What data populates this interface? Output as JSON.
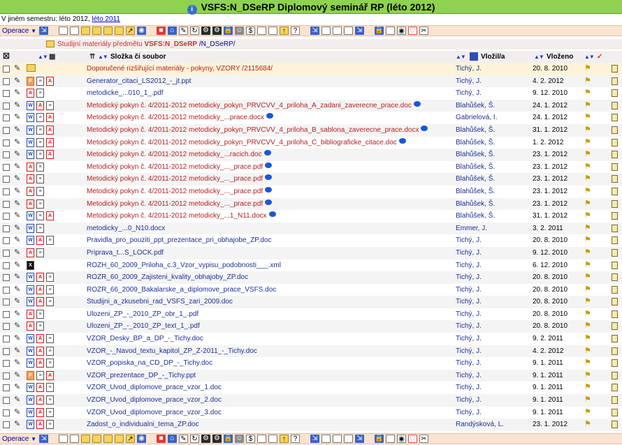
{
  "title": "VSFS:N_DSeRP Diplomový seminář RP (léto 2012)",
  "semester": {
    "prefix": "V jiném semestru: léto 2012,",
    "link": "léto 2011"
  },
  "toolbar": {
    "operace": "Operace"
  },
  "path": {
    "prefix": "Studijní materiály předmětu",
    "course": "VSFS:N_DSeRP",
    "suffix": "/N_DSeRP/"
  },
  "header": {
    "col_file": "Složka či soubor",
    "col_author": "Vložil/a",
    "col_date": "Vloženo"
  },
  "rows": [
    {
      "name": "Doporučené rizšiřující materiály - pokyny, VZORY",
      "extra": "/2115684/",
      "author": "Tichý, J.",
      "date": "20.  8. 2010",
      "style": "red",
      "icons": [
        "fold"
      ],
      "first": true
    },
    {
      "name": "Generator_citaci_LS2012_-_jt.ppt",
      "author": "Tichý, J.",
      "date": "4.  2. 2012",
      "style": "blue",
      "icons": [
        "ppt",
        "txt",
        "pdf"
      ]
    },
    {
      "name": "metodicke_...010_1_.pdf",
      "author": "Tichý, J.",
      "date": "9. 12. 2010",
      "style": "blue",
      "icons": [
        "pdf",
        "txt"
      ]
    },
    {
      "name": "Metodický pokyn č. 4/2011-2012 metodicky_pokyn_PRVCVV_4_priloha_A_zadani_zaverecne_prace.doc",
      "author": "Blahůšek, Š.",
      "date": "24.  1. 2012",
      "style": "red",
      "icons": [
        "word",
        "pdf",
        "txt"
      ],
      "bubble": true
    },
    {
      "name": "Metodický pokyn č. 4/2011-2012 metodicky_...prace.docx",
      "author": "Gabrielová, I.",
      "date": "24.  1. 2012",
      "style": "red",
      "icons": [
        "word",
        "txt",
        "pdf"
      ],
      "bubble": true
    },
    {
      "name": "Metodický pokyn č. 4/2011-2012 metodicky_pokyn_PRVCVV_4_priloha_B_sablona_zaverecne_prace.docx",
      "author": "Blahůšek, Š.",
      "date": "31.  1. 2012",
      "style": "red",
      "icons": [
        "word",
        "txt",
        "pdf"
      ],
      "bubble": true
    },
    {
      "name": "Metodický pokyn č. 4/2011-2012 metodicky_pokyn_PRVCVV_4_priloha_C_bibliograficke_citace.doc",
      "author": "Blahůšek, Š.",
      "date": "1.  2. 2012",
      "style": "red",
      "icons": [
        "word",
        "txt",
        "pdf"
      ],
      "bubble": true
    },
    {
      "name": "Metodický pokyn č. 4/2011-2012 metodicky_...racich.doc",
      "author": "Blahůšek, Š.",
      "date": "23.  1. 2012",
      "style": "red",
      "icons": [
        "word",
        "txt",
        "pdf"
      ],
      "bubble": true
    },
    {
      "name": "Metodický pokyn č. 4/2011-2012 metodicky_..._prace.pdf",
      "author": "Blahůšek, Š.",
      "date": "23.  1. 2012",
      "style": "red",
      "icons": [
        "pdf",
        "txt"
      ],
      "bubble": true
    },
    {
      "name": "Metodický pokyn č. 4/2011-2012 metodicky_..._prace.pdf",
      "author": "Blahůšek, Š.",
      "date": "23.  1. 2012",
      "style": "red",
      "icons": [
        "pdf",
        "txt"
      ],
      "bubble": true
    },
    {
      "name": "Metodický pokyn č. 4/2011-2012 metodicky_..._prace.pdf",
      "author": "Blahůšek, Š.",
      "date": "23.  1. 2012",
      "style": "red",
      "icons": [
        "pdf",
        "txt"
      ],
      "bubble": true
    },
    {
      "name": "Metodický pokyn č. 4/2011-2012 metodicky_..._prace.pdf",
      "author": "Blahůšek, Š.",
      "date": "23.  1. 2012",
      "style": "red",
      "icons": [
        "pdf",
        "txt"
      ],
      "bubble": true
    },
    {
      "name": "Metodický pokyn č. 4/2011-2012 metodicky_...1_N11.docx",
      "author": "Blahůšek, Š.",
      "date": "31.  1. 2012",
      "style": "red",
      "icons": [
        "word",
        "txt",
        "pdf"
      ],
      "bubble": true
    },
    {
      "name": "metodicky_...0_N10.docx",
      "author": "Emmer, J.",
      "date": "3.  2. 2011",
      "style": "blue",
      "icons": [
        "word",
        "txt"
      ]
    },
    {
      "name": "Pravidla_pro_pouziti_ppt_prezentace_pri_obhajobe_ZP.doc",
      "author": "Tichý, J.",
      "date": "20.  8. 2010",
      "style": "blue",
      "icons": [
        "word",
        "pdf",
        "txt"
      ]
    },
    {
      "name": "Priprava_t...S_LOCK.pdf",
      "author": "Tichý, J.",
      "date": "9. 12. 2010",
      "style": "blue",
      "icons": [
        "pdf",
        "txt"
      ]
    },
    {
      "name": "ROZH_60_2009_Priloha_c.3_Vzor_vypisu_podobnosti___.xml",
      "author": "Tichý, J.",
      "date": "6. 12. 2010",
      "style": "blue",
      "icons": [
        "xml"
      ]
    },
    {
      "name": "ROZR_60_2009_Zajisteni_kvality_obhajoby_ZP.doc",
      "author": "Tichý, J.",
      "date": "20.  8. 2010",
      "style": "blue",
      "icons": [
        "word",
        "pdf",
        "txt"
      ]
    },
    {
      "name": "ROZR_66_2009_Bakalarske_a_diplomove_prace_VSFS.doc",
      "author": "Tichý, J.",
      "date": "20.  8. 2010",
      "style": "blue",
      "icons": [
        "word",
        "pdf",
        "txt"
      ]
    },
    {
      "name": "Studijni_a_zkusebni_rad_VSFS_zari_2009.doc",
      "author": "Tichý, J.",
      "date": "20.  8. 2010",
      "style": "blue",
      "icons": [
        "word",
        "pdf",
        "txt"
      ]
    },
    {
      "name": "Ulozeni_ZP_-_2010_ZP_obr_1_.pdf",
      "author": "Tichý, J.",
      "date": "20.  8. 2010",
      "style": "blue",
      "icons": [
        "pdf",
        "txt"
      ]
    },
    {
      "name": "Ulozeni_ZP_-_2010_ZP_text_1_.pdf",
      "author": "Tichý, J.",
      "date": "20.  8. 2010",
      "style": "blue",
      "icons": [
        "pdf",
        "txt"
      ]
    },
    {
      "name": "VZOR_Desky_BP_a_DP_-_Tichy.doc",
      "author": "Tichý, J.",
      "date": "9.  2. 2011",
      "style": "blue",
      "icons": [
        "word",
        "pdf",
        "txt"
      ]
    },
    {
      "name": "VZOR_-_Navod_textu_kapitol_ZP_Z-2011_-_Tichy.doc",
      "author": "Tichý, J.",
      "date": "4.  2. 2012",
      "style": "blue",
      "icons": [
        "word",
        "pdf",
        "txt"
      ]
    },
    {
      "name": "VZOR_popiska_na_CD_DP_-_Tichy.doc",
      "author": "Tichý, J.",
      "date": "9.  1. 2011",
      "style": "blue",
      "icons": [
        "word",
        "pdf",
        "txt"
      ]
    },
    {
      "name": "VZOR_prezentace_DP_-_Tichy.ppt",
      "author": "Tichý, J.",
      "date": "9.  1. 2011",
      "style": "blue",
      "icons": [
        "ppt",
        "txt",
        "pdf"
      ]
    },
    {
      "name": "VZOR_Uvod_diplomove_prace_vzor_1.doc",
      "author": "Tichý, J.",
      "date": "9.  1. 2011",
      "style": "blue",
      "icons": [
        "word",
        "pdf",
        "txt"
      ]
    },
    {
      "name": "VZOR_Uvod_diplomove_prace_vzor_2.doc",
      "author": "Tichý, J.",
      "date": "9.  1. 2011",
      "style": "blue",
      "icons": [
        "word",
        "pdf",
        "txt"
      ]
    },
    {
      "name": "VZOR_Uvod_diplomove_prace_vzor_3.doc",
      "author": "Tichý, J.",
      "date": "9.  1. 2011",
      "style": "blue",
      "icons": [
        "word",
        "pdf",
        "txt"
      ]
    },
    {
      "name": "Zadost_o_individualni_tema_ZP.doc",
      "author": "Randýsková, L.",
      "date": "23.  1. 2012",
      "style": "blue",
      "icons": [
        "word",
        "pdf",
        "txt"
      ]
    }
  ]
}
